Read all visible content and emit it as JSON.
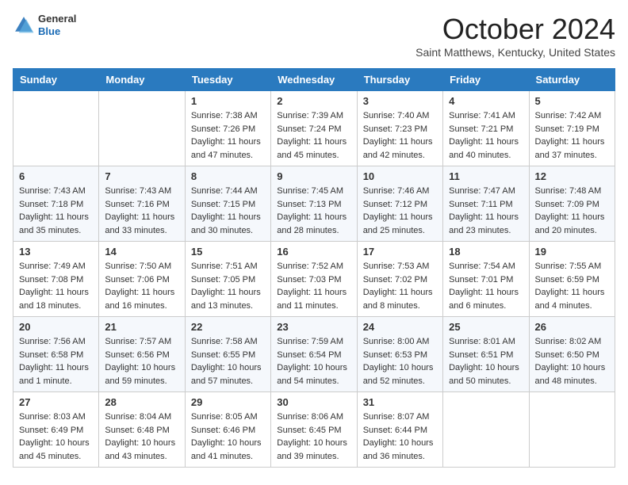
{
  "header": {
    "logo": {
      "general": "General",
      "blue": "Blue"
    },
    "title": "October 2024",
    "subtitle": "Saint Matthews, Kentucky, United States"
  },
  "days_of_week": [
    "Sunday",
    "Monday",
    "Tuesday",
    "Wednesday",
    "Thursday",
    "Friday",
    "Saturday"
  ],
  "weeks": [
    [
      {
        "day": "",
        "sunrise": "",
        "sunset": "",
        "daylight": ""
      },
      {
        "day": "",
        "sunrise": "",
        "sunset": "",
        "daylight": ""
      },
      {
        "day": "1",
        "sunrise": "Sunrise: 7:38 AM",
        "sunset": "Sunset: 7:26 PM",
        "daylight": "Daylight: 11 hours and 47 minutes."
      },
      {
        "day": "2",
        "sunrise": "Sunrise: 7:39 AM",
        "sunset": "Sunset: 7:24 PM",
        "daylight": "Daylight: 11 hours and 45 minutes."
      },
      {
        "day": "3",
        "sunrise": "Sunrise: 7:40 AM",
        "sunset": "Sunset: 7:23 PM",
        "daylight": "Daylight: 11 hours and 42 minutes."
      },
      {
        "day": "4",
        "sunrise": "Sunrise: 7:41 AM",
        "sunset": "Sunset: 7:21 PM",
        "daylight": "Daylight: 11 hours and 40 minutes."
      },
      {
        "day": "5",
        "sunrise": "Sunrise: 7:42 AM",
        "sunset": "Sunset: 7:19 PM",
        "daylight": "Daylight: 11 hours and 37 minutes."
      }
    ],
    [
      {
        "day": "6",
        "sunrise": "Sunrise: 7:43 AM",
        "sunset": "Sunset: 7:18 PM",
        "daylight": "Daylight: 11 hours and 35 minutes."
      },
      {
        "day": "7",
        "sunrise": "Sunrise: 7:43 AM",
        "sunset": "Sunset: 7:16 PM",
        "daylight": "Daylight: 11 hours and 33 minutes."
      },
      {
        "day": "8",
        "sunrise": "Sunrise: 7:44 AM",
        "sunset": "Sunset: 7:15 PM",
        "daylight": "Daylight: 11 hours and 30 minutes."
      },
      {
        "day": "9",
        "sunrise": "Sunrise: 7:45 AM",
        "sunset": "Sunset: 7:13 PM",
        "daylight": "Daylight: 11 hours and 28 minutes."
      },
      {
        "day": "10",
        "sunrise": "Sunrise: 7:46 AM",
        "sunset": "Sunset: 7:12 PM",
        "daylight": "Daylight: 11 hours and 25 minutes."
      },
      {
        "day": "11",
        "sunrise": "Sunrise: 7:47 AM",
        "sunset": "Sunset: 7:11 PM",
        "daylight": "Daylight: 11 hours and 23 minutes."
      },
      {
        "day": "12",
        "sunrise": "Sunrise: 7:48 AM",
        "sunset": "Sunset: 7:09 PM",
        "daylight": "Daylight: 11 hours and 20 minutes."
      }
    ],
    [
      {
        "day": "13",
        "sunrise": "Sunrise: 7:49 AM",
        "sunset": "Sunset: 7:08 PM",
        "daylight": "Daylight: 11 hours and 18 minutes."
      },
      {
        "day": "14",
        "sunrise": "Sunrise: 7:50 AM",
        "sunset": "Sunset: 7:06 PM",
        "daylight": "Daylight: 11 hours and 16 minutes."
      },
      {
        "day": "15",
        "sunrise": "Sunrise: 7:51 AM",
        "sunset": "Sunset: 7:05 PM",
        "daylight": "Daylight: 11 hours and 13 minutes."
      },
      {
        "day": "16",
        "sunrise": "Sunrise: 7:52 AM",
        "sunset": "Sunset: 7:03 PM",
        "daylight": "Daylight: 11 hours and 11 minutes."
      },
      {
        "day": "17",
        "sunrise": "Sunrise: 7:53 AM",
        "sunset": "Sunset: 7:02 PM",
        "daylight": "Daylight: 11 hours and 8 minutes."
      },
      {
        "day": "18",
        "sunrise": "Sunrise: 7:54 AM",
        "sunset": "Sunset: 7:01 PM",
        "daylight": "Daylight: 11 hours and 6 minutes."
      },
      {
        "day": "19",
        "sunrise": "Sunrise: 7:55 AM",
        "sunset": "Sunset: 6:59 PM",
        "daylight": "Daylight: 11 hours and 4 minutes."
      }
    ],
    [
      {
        "day": "20",
        "sunrise": "Sunrise: 7:56 AM",
        "sunset": "Sunset: 6:58 PM",
        "daylight": "Daylight: 11 hours and 1 minute."
      },
      {
        "day": "21",
        "sunrise": "Sunrise: 7:57 AM",
        "sunset": "Sunset: 6:56 PM",
        "daylight": "Daylight: 10 hours and 59 minutes."
      },
      {
        "day": "22",
        "sunrise": "Sunrise: 7:58 AM",
        "sunset": "Sunset: 6:55 PM",
        "daylight": "Daylight: 10 hours and 57 minutes."
      },
      {
        "day": "23",
        "sunrise": "Sunrise: 7:59 AM",
        "sunset": "Sunset: 6:54 PM",
        "daylight": "Daylight: 10 hours and 54 minutes."
      },
      {
        "day": "24",
        "sunrise": "Sunrise: 8:00 AM",
        "sunset": "Sunset: 6:53 PM",
        "daylight": "Daylight: 10 hours and 52 minutes."
      },
      {
        "day": "25",
        "sunrise": "Sunrise: 8:01 AM",
        "sunset": "Sunset: 6:51 PM",
        "daylight": "Daylight: 10 hours and 50 minutes."
      },
      {
        "day": "26",
        "sunrise": "Sunrise: 8:02 AM",
        "sunset": "Sunset: 6:50 PM",
        "daylight": "Daylight: 10 hours and 48 minutes."
      }
    ],
    [
      {
        "day": "27",
        "sunrise": "Sunrise: 8:03 AM",
        "sunset": "Sunset: 6:49 PM",
        "daylight": "Daylight: 10 hours and 45 minutes."
      },
      {
        "day": "28",
        "sunrise": "Sunrise: 8:04 AM",
        "sunset": "Sunset: 6:48 PM",
        "daylight": "Daylight: 10 hours and 43 minutes."
      },
      {
        "day": "29",
        "sunrise": "Sunrise: 8:05 AM",
        "sunset": "Sunset: 6:46 PM",
        "daylight": "Daylight: 10 hours and 41 minutes."
      },
      {
        "day": "30",
        "sunrise": "Sunrise: 8:06 AM",
        "sunset": "Sunset: 6:45 PM",
        "daylight": "Daylight: 10 hours and 39 minutes."
      },
      {
        "day": "31",
        "sunrise": "Sunrise: 8:07 AM",
        "sunset": "Sunset: 6:44 PM",
        "daylight": "Daylight: 10 hours and 36 minutes."
      },
      {
        "day": "",
        "sunrise": "",
        "sunset": "",
        "daylight": ""
      },
      {
        "day": "",
        "sunrise": "",
        "sunset": "",
        "daylight": ""
      }
    ]
  ]
}
